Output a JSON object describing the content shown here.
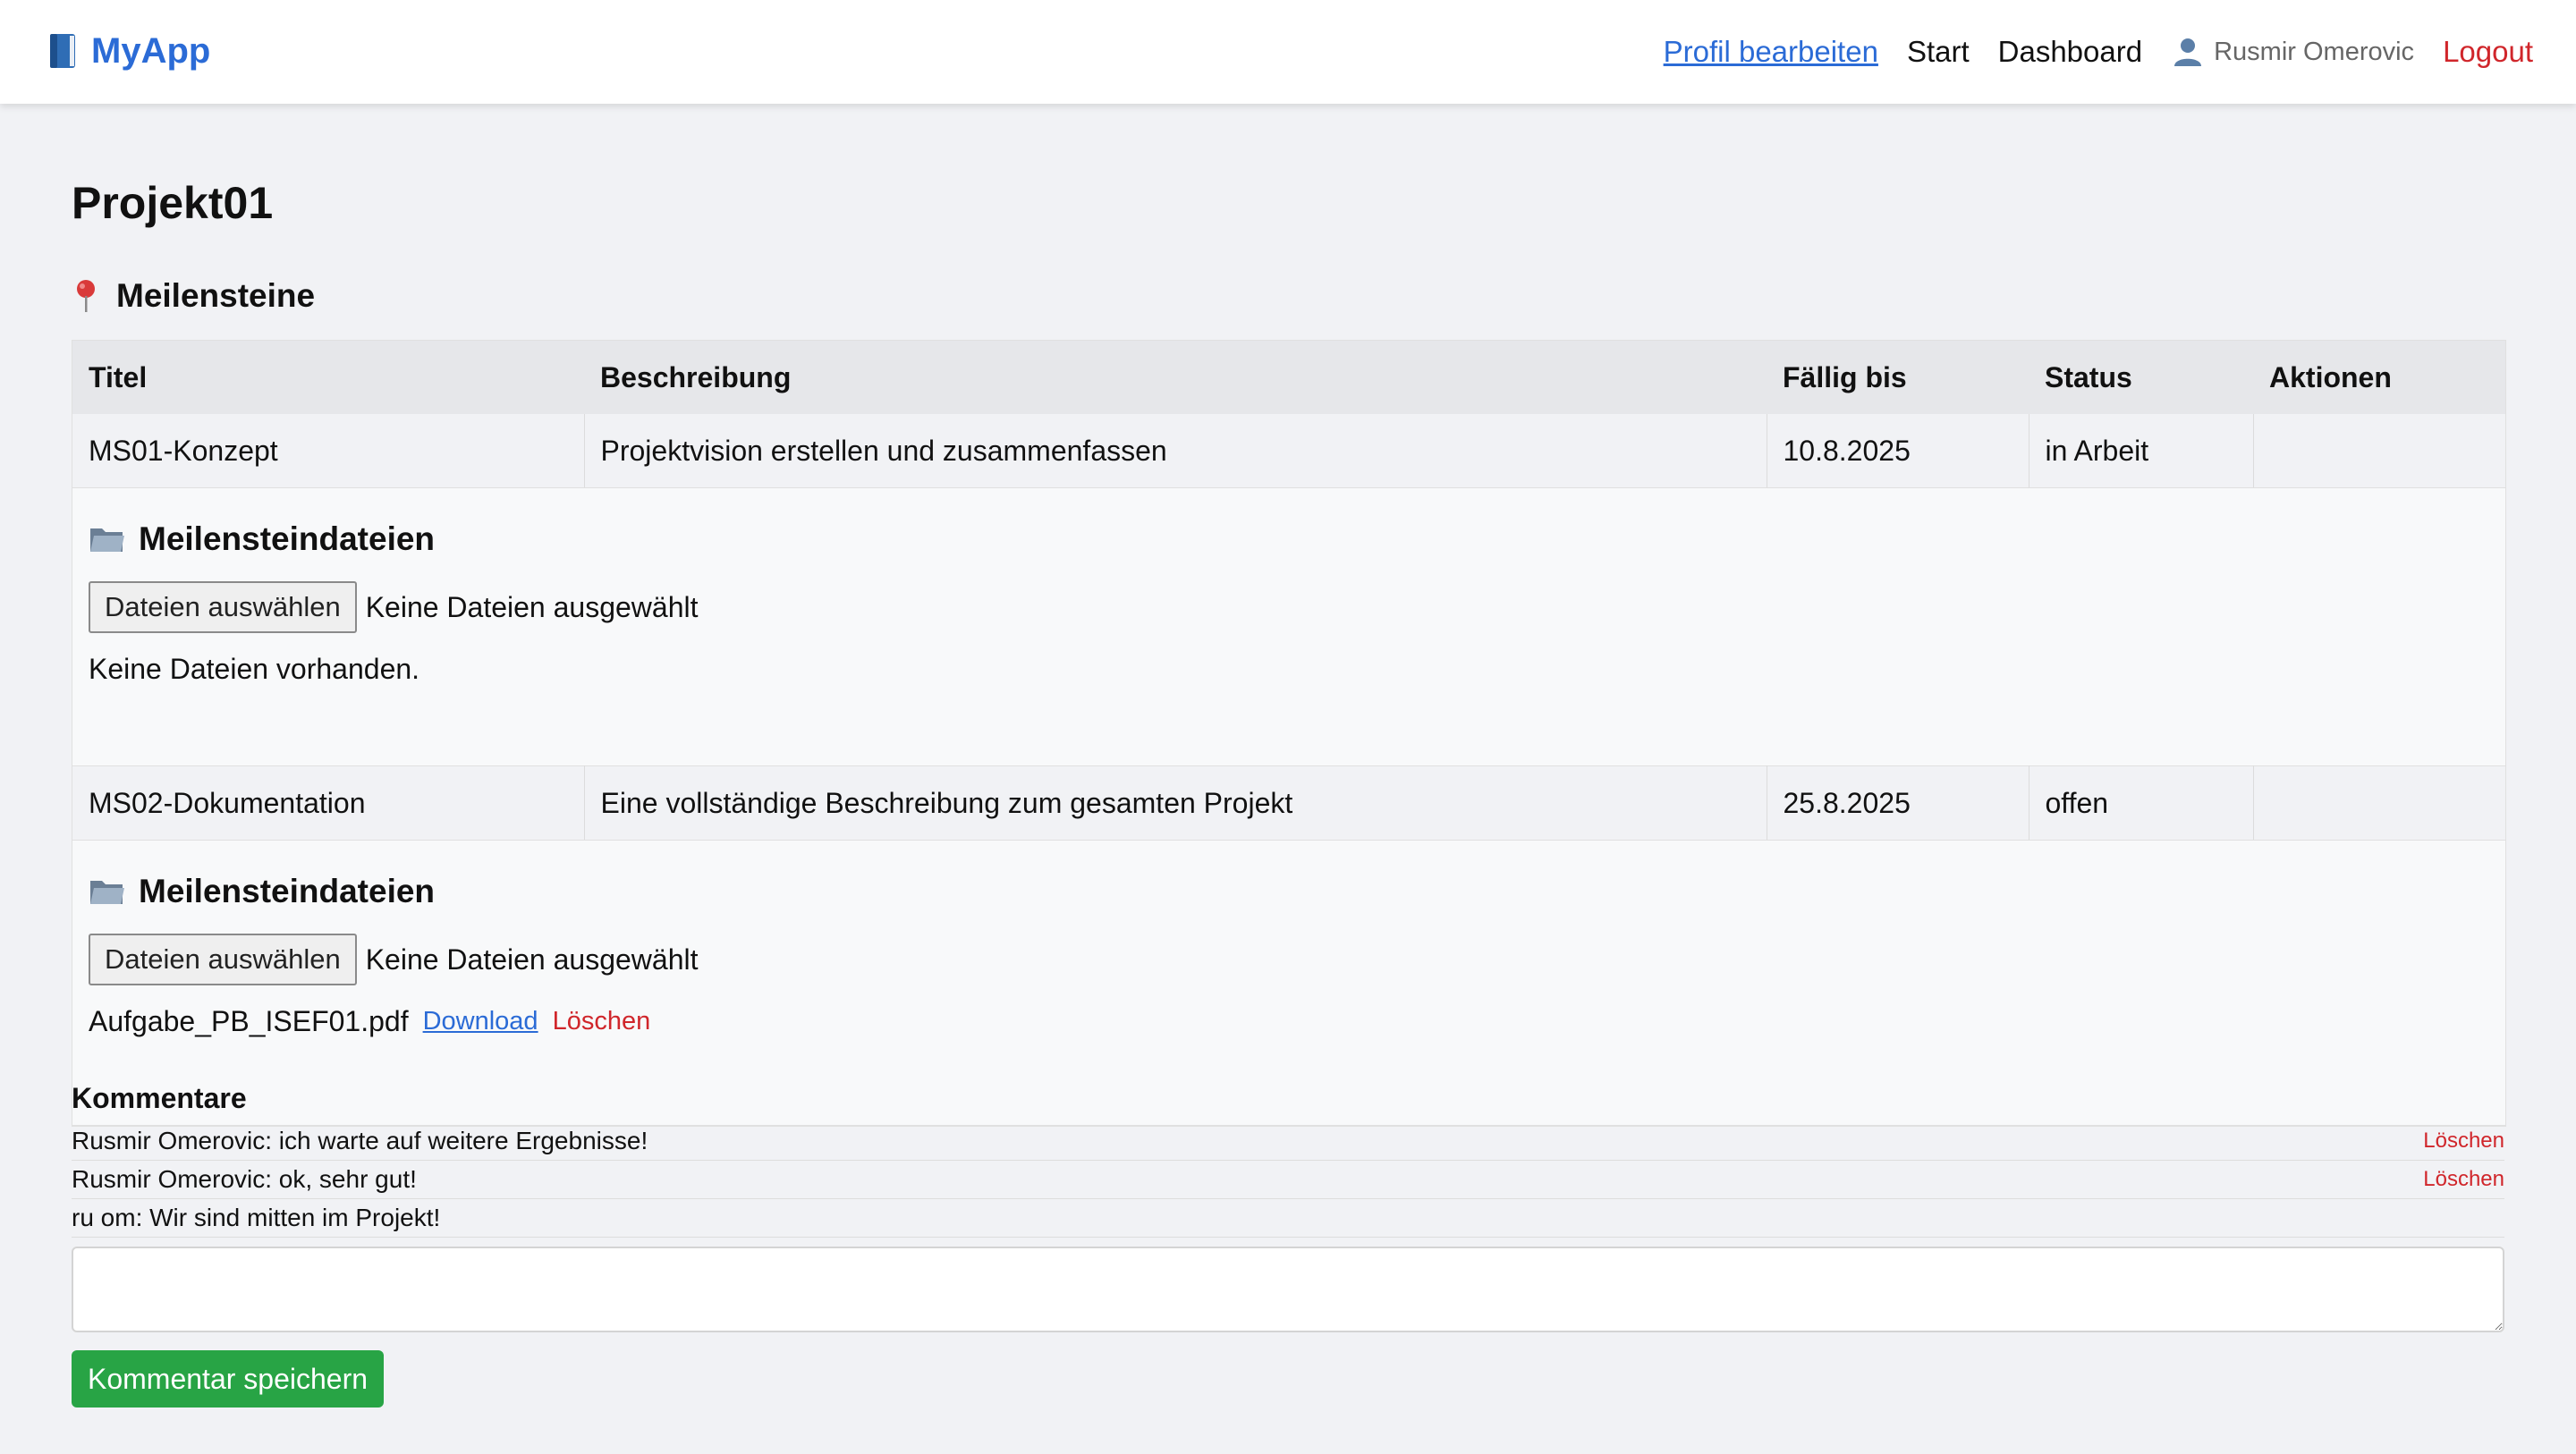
{
  "nav": {
    "brand": "MyApp",
    "profile": "Profil bearbeiten",
    "start": "Start",
    "dashboard": "Dashboard",
    "user": "Rusmir Omerovic",
    "logout": "Logout"
  },
  "project": {
    "title": "Projekt01"
  },
  "milestones": {
    "section_title": "Meilensteine",
    "columns": {
      "title": "Titel",
      "description": "Beschreibung",
      "due": "Fällig bis",
      "status": "Status",
      "actions": "Aktionen"
    },
    "rows": [
      {
        "title": "MS01-Konzept",
        "description": "Projektvision erstellen und zusammenfassen",
        "due": "10.8.2025",
        "status": "in Arbeit",
        "actions": "",
        "files_title": "Meilensteindateien",
        "file_button": "Dateien auswählen",
        "file_status": "Keine Dateien ausgewählt",
        "empty_text": "Keine Dateien vorhanden."
      },
      {
        "title": "MS02-Dokumentation",
        "description": "Eine vollständige Beschreibung zum gesamten Projekt",
        "due": "25.8.2025",
        "status": "offen",
        "actions": "",
        "files_title": "Meilensteindateien",
        "file_button": "Dateien auswählen",
        "file_status": "Keine Dateien ausgewählt",
        "file_name": "Aufgabe_PB_ISEF01.pdf",
        "download": "Download",
        "delete": "Löschen"
      }
    ]
  },
  "comments": {
    "title": "Kommentare",
    "items": [
      {
        "text": "Rusmir Omerovic: ich warte auf weitere Ergebnisse!",
        "delete": "Löschen"
      },
      {
        "text": "Rusmir Omerovic: ok, sehr gut!",
        "delete": "Löschen"
      },
      {
        "text": "ru om: Wir sind mitten im Projekt!"
      }
    ],
    "input_value": "",
    "save": "Kommentar speichern"
  }
}
